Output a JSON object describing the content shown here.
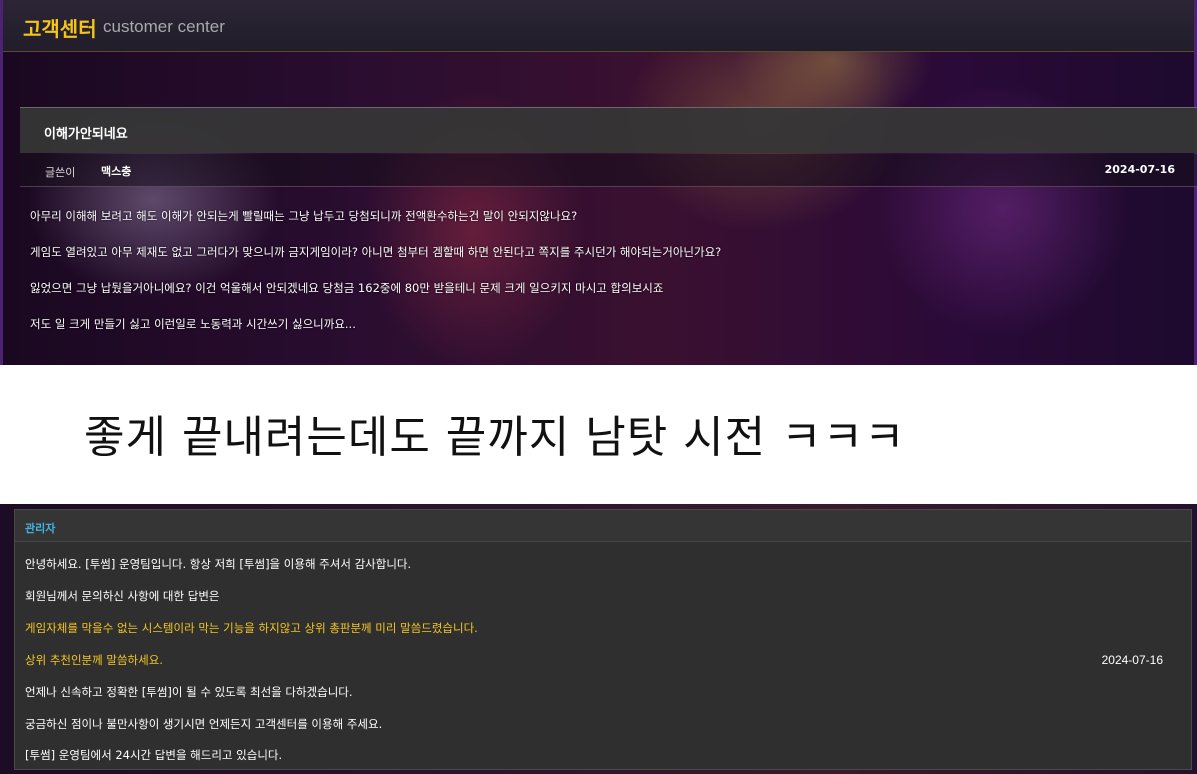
{
  "header": {
    "brand_kr": "고객센터",
    "brand_en": "customer center"
  },
  "post": {
    "title": "이해가안되네요",
    "author_label": "글쓴이",
    "author": "맥스충",
    "date": "2024-07-16",
    "lines": [
      "아무리 이해해 보려고 해도 이해가 안되는게 빨릴때는 그냥 납두고 당첨되니까 전액환수하는건 말이 안되지않나요?",
      "게임도 열려있고 아무 제재도 없고 그러다가 맞으니까 금지게임이라? 아니면 첨부터 겜할때 하면 안된다고 쪽지를 주시던가 해야되는거아닌가요?",
      "잃었으면 그냥 납뒀을거아니에요? 이건 억울해서 안되겠네요 당첨금 162중에 80만 받을테니 문제 크게 일으키지 마시고 합의보시죠",
      "저도 일 크게 만들기 싫고 이런일로 노동력과 시간쓰기 싫으니까요..."
    ]
  },
  "caption": "좋게 끝내려는데도 끝까지 남탓 시전 ㅋㅋㅋ",
  "answer": {
    "author": "관리자",
    "date": "2024-07-16",
    "lines": [
      "안녕하세요. [투썸] 운영팀입니다. 항상 저희 [투썸]을 이용해 주셔서 감사합니다.",
      "회원님께서 문의하신 사항에 대한 답변은",
      "게임자체를 막을수 없는 시스템이라 막는 기능을 하지않고 상위 총판분께 미리 말씀드렸습니다.",
      "상위 추천인분께 말씀하세요.",
      "언제나 신속하고 정확한 [투썸]이 될 수 있도록 최선을 다하겠습니다.",
      "궁금하신 점이나 불만사항이 생기시면 언제든지 고객센터를 이용해 주세요.",
      "[투썸] 운영팀에서 24시간 답변을 해드리고 있습니다."
    ]
  },
  "colors": {
    "brand": "#f5c518",
    "highlight": "#f3c623",
    "admin": "#3fb4e0"
  }
}
